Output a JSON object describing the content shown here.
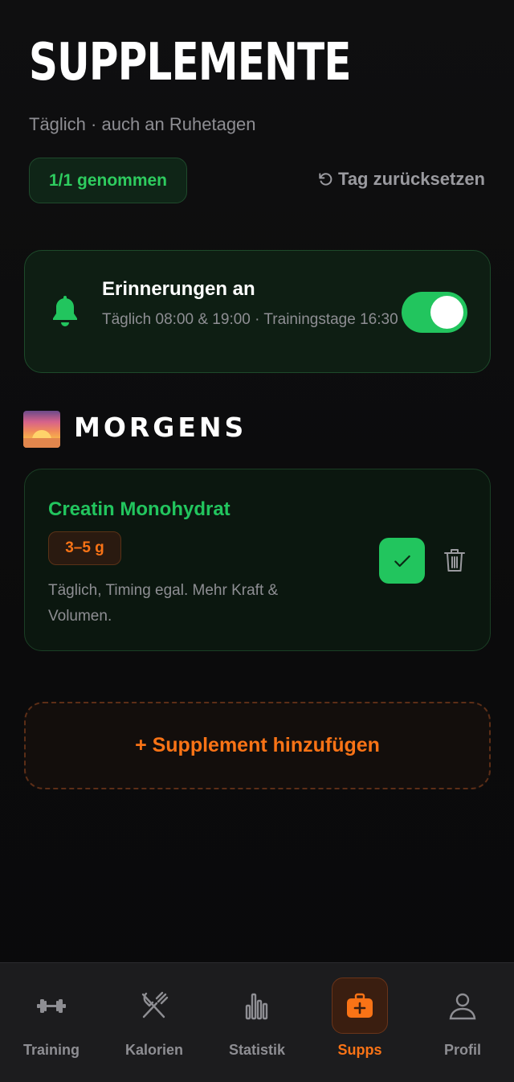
{
  "header": {
    "title": "SUPPLEMENTE",
    "subtitle": "Täglich · auch an Ruhetagen",
    "taken_badge": "1/1 genommen",
    "reset_label": "Tag zurücksetzen"
  },
  "reminder": {
    "title": "Erinnerungen an",
    "description": "Täglich 08:00 & 19:00 · Trainingstage 16:30",
    "enabled": true
  },
  "section": {
    "title": "MORGENS",
    "icon": "sunrise-icon"
  },
  "supplements": [
    {
      "name": "Creatin Monohydrat",
      "dose": "3–5 g",
      "note": "Täglich, Timing egal. Mehr Kraft & Volumen.",
      "taken": true
    }
  ],
  "add_button": {
    "label": "+ Supplement hinzufügen"
  },
  "tabbar": {
    "items": [
      {
        "label": "Training",
        "icon": "dumbbell-icon"
      },
      {
        "label": "Kalorien",
        "icon": "fork-knife-icon"
      },
      {
        "label": "Statistik",
        "icon": "bar-chart-icon"
      },
      {
        "label": "Supps",
        "icon": "supplement-box-icon",
        "active": true
      },
      {
        "label": "Profil",
        "icon": "person-icon"
      }
    ]
  },
  "colors": {
    "accent_green": "#22c55e",
    "accent_orange": "#f97316",
    "background": "#0b0b0c",
    "muted_text": "#8e8e93"
  }
}
